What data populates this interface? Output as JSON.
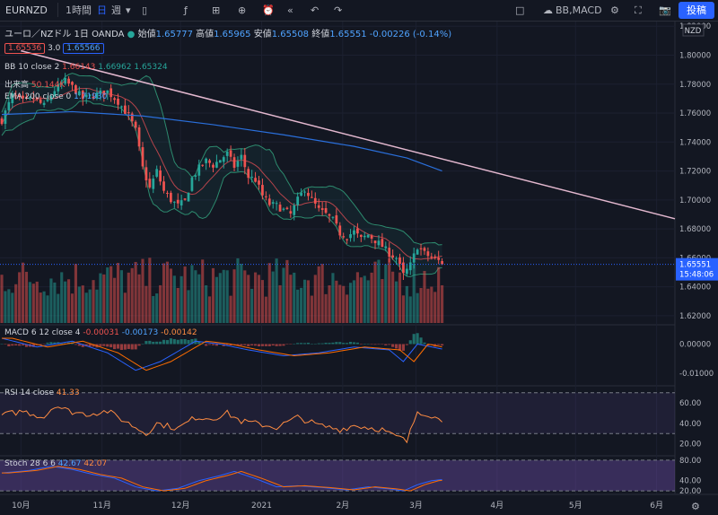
{
  "toolbar": {
    "symbol": "EURNZD",
    "interval_hour": "1時間",
    "interval_day": "日",
    "interval_week": "週",
    "indicators_label": "BB,MACD",
    "post_label": "投稿"
  },
  "header": {
    "title": "ユーロ／NZドル",
    "interval": "1日",
    "source": "OANDA",
    "open_label": "始値",
    "open": "1.65777",
    "high_label": "高値",
    "high": "1.65965",
    "low_label": "安値",
    "low": "1.65508",
    "close_label": "終値",
    "close": "1.65551",
    "change": "-0.00226 (-0.14%)",
    "bid": "1.65536",
    "spread": "3.0",
    "ask": "1.65566"
  },
  "legends": {
    "bb": {
      "name": "BB 10 close 2",
      "v1": "1.66143",
      "v2": "1.66962",
      "v3": "1.65324"
    },
    "volume": {
      "name": "出来高",
      "v1": "50.144K"
    },
    "ema": {
      "name": "EMA 200 close 0",
      "v1": "1.71930"
    },
    "macd": {
      "name": "MACD 6 12 close 4",
      "v1": "-0.00031",
      "v2": "-0.00173",
      "v3": "-0.00142"
    },
    "rsi": {
      "name": "RSI 14 close",
      "v1": "41.33"
    },
    "stoch": {
      "name": "Stoch 28 6 6",
      "v1": "42.67",
      "v2": "42.07"
    }
  },
  "axis": {
    "currency": "NZD",
    "last_price": "1.65551",
    "countdown": "15:48:06",
    "price_ticks": [
      "1.82000",
      "1.80000",
      "1.78000",
      "1.76000",
      "1.74000",
      "1.72000",
      "1.70000",
      "1.68000",
      "1.66000",
      "1.64000",
      "1.62000"
    ],
    "macd_ticks": [
      "0.00000",
      "-0.01000"
    ],
    "rsi_ticks": [
      "60.00",
      "40.00",
      "20.00"
    ],
    "stoch_ticks": [
      "80.00",
      "40.00",
      "20.00"
    ],
    "time_labels": [
      "10月",
      "11月",
      "12月",
      "2021",
      "2月",
      "3月",
      "4月",
      "5月",
      "6月"
    ]
  },
  "chart_data": {
    "type": "candlestick",
    "x_range": [
      "2020-09-23",
      "2021-06-08"
    ],
    "last_bar": "2021-03-11",
    "price_range": [
      1.615,
      1.822
    ],
    "price_path": [
      [
        0,
        1.755
      ],
      [
        3,
        1.772
      ],
      [
        6,
        1.768
      ],
      [
        9,
        1.77
      ],
      [
        12,
        1.765
      ],
      [
        15,
        1.776
      ],
      [
        18,
        1.782
      ],
      [
        20,
        1.778
      ],
      [
        23,
        1.77
      ],
      [
        27,
        1.773
      ],
      [
        30,
        1.775
      ],
      [
        33,
        1.768
      ],
      [
        36,
        1.758
      ],
      [
        38,
        1.748
      ],
      [
        40,
        1.722
      ],
      [
        42,
        1.708
      ],
      [
        44,
        1.72
      ],
      [
        46,
        1.706
      ],
      [
        48,
        1.7
      ],
      [
        50,
        1.696
      ],
      [
        52,
        1.699
      ],
      [
        54,
        1.715
      ],
      [
        56,
        1.722
      ],
      [
        58,
        1.727
      ],
      [
        60,
        1.724
      ],
      [
        62,
        1.728
      ],
      [
        64,
        1.732
      ],
      [
        66,
        1.723
      ],
      [
        68,
        1.73
      ],
      [
        70,
        1.716
      ],
      [
        72,
        1.714
      ],
      [
        74,
        1.703
      ],
      [
        76,
        1.697
      ],
      [
        78,
        1.696
      ],
      [
        80,
        1.693
      ],
      [
        82,
        1.69
      ],
      [
        84,
        1.7
      ],
      [
        86,
        1.708
      ],
      [
        88,
        1.7
      ],
      [
        90,
        1.693
      ],
      [
        92,
        1.69
      ],
      [
        94,
        1.686
      ],
      [
        96,
        1.677
      ],
      [
        98,
        1.675
      ],
      [
        100,
        1.678
      ],
      [
        102,
        1.673
      ],
      [
        104,
        1.676
      ],
      [
        106,
        1.672
      ],
      [
        108,
        1.668
      ],
      [
        110,
        1.663
      ],
      [
        112,
        1.66
      ],
      [
        114,
        1.648
      ],
      [
        116,
        1.655
      ],
      [
        118,
        1.668
      ],
      [
        120,
        1.663
      ],
      [
        122,
        1.66
      ],
      [
        124,
        1.658
      ],
      [
        125,
        1.6555
      ]
    ],
    "ema200_path": [
      [
        0,
        1.759
      ],
      [
        20,
        1.761
      ],
      [
        40,
        1.758
      ],
      [
        60,
        1.752
      ],
      [
        80,
        1.745
      ],
      [
        100,
        1.737
      ],
      [
        115,
        1.729
      ],
      [
        125,
        1.72
      ]
    ],
    "trendline": {
      "from": [
        "2020-10-01",
        1.803
      ],
      "to": [
        "2021-06-08",
        1.687
      ]
    },
    "volume_max_k": 110,
    "macd": {
      "range": [
        -0.014,
        0.006
      ],
      "path": [
        [
          0,
          0.002
        ],
        [
          10,
          -0.001
        ],
        [
          20,
          0.001
        ],
        [
          30,
          -0.003
        ],
        [
          38,
          -0.009
        ],
        [
          45,
          -0.006
        ],
        [
          55,
          0.001
        ],
        [
          62,
          0.0
        ],
        [
          70,
          -0.002
        ],
        [
          80,
          -0.004
        ],
        [
          90,
          -0.003
        ],
        [
          100,
          -0.001
        ],
        [
          110,
          -0.002
        ],
        [
          114,
          -0.006
        ],
        [
          118,
          0.0
        ],
        [
          125,
          -0.0017
        ]
      ]
    },
    "rsi": {
      "range": [
        10,
        75
      ],
      "bands": [
        70,
        30
      ],
      "path": [
        [
          0,
          48
        ],
        [
          6,
          52
        ],
        [
          12,
          46
        ],
        [
          15,
          58
        ],
        [
          19,
          52
        ],
        [
          24,
          49
        ],
        [
          30,
          52
        ],
        [
          34,
          44
        ],
        [
          38,
          36
        ],
        [
          41,
          30
        ],
        [
          44,
          40
        ],
        [
          50,
          35
        ],
        [
          55,
          46
        ],
        [
          60,
          45
        ],
        [
          64,
          50
        ],
        [
          68,
          42
        ],
        [
          72,
          40
        ],
        [
          78,
          36
        ],
        [
          84,
          46
        ],
        [
          90,
          38
        ],
        [
          96,
          34
        ],
        [
          100,
          38
        ],
        [
          104,
          36
        ],
        [
          108,
          34
        ],
        [
          111,
          28
        ],
        [
          113,
          26
        ],
        [
          115,
          22
        ],
        [
          118,
          52
        ],
        [
          122,
          48
        ],
        [
          125,
          41.33
        ]
      ]
    },
    "stoch": {
      "range": [
        15,
        85
      ],
      "bands": [
        80,
        20
      ],
      "path": [
        [
          0,
          55
        ],
        [
          8,
          60
        ],
        [
          14,
          68
        ],
        [
          20,
          62
        ],
        [
          26,
          52
        ],
        [
          32,
          45
        ],
        [
          38,
          28
        ],
        [
          44,
          20
        ],
        [
          50,
          25
        ],
        [
          56,
          40
        ],
        [
          62,
          50
        ],
        [
          66,
          58
        ],
        [
          72,
          44
        ],
        [
          78,
          28
        ],
        [
          84,
          30
        ],
        [
          92,
          26
        ],
        [
          98,
          22
        ],
        [
          104,
          28
        ],
        [
          110,
          24
        ],
        [
          114,
          20
        ],
        [
          118,
          32
        ],
        [
          122,
          40
        ],
        [
          125,
          42.07
        ]
      ]
    }
  },
  "colors": {
    "up": "#26a69a",
    "down": "#ef5350",
    "ema": "#2a6fdb",
    "trend": "#e3b8cf",
    "bb_line": "#2d8a6e",
    "bb_basis": "#b5444b",
    "rsi": "#ff8c42",
    "stoch_k": "#2962ff",
    "stoch_d": "#ff6d00"
  }
}
